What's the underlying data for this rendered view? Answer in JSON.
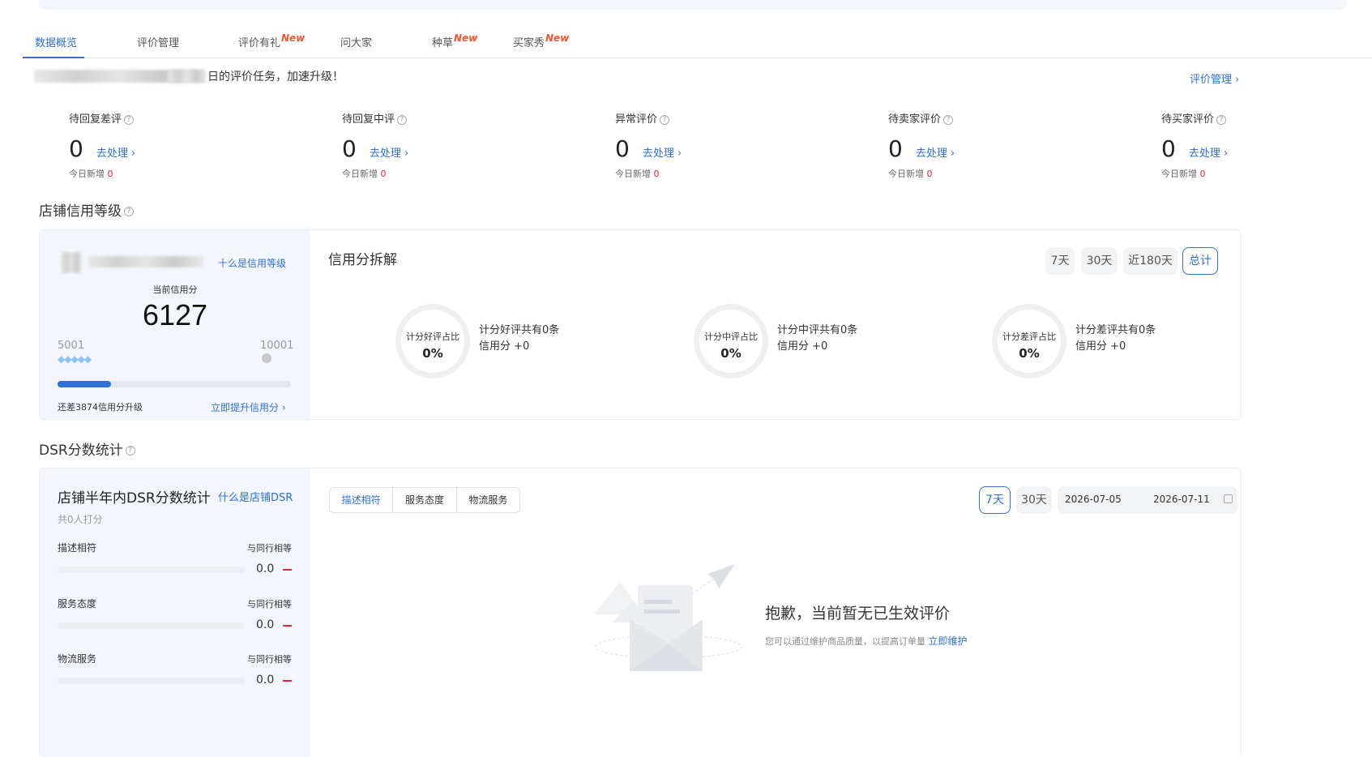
{
  "tabs": [
    {
      "label": "数据概览",
      "new": ""
    },
    {
      "label": "评价管理",
      "new": ""
    },
    {
      "label": "评价有礼",
      "new": "New"
    },
    {
      "label": "问大家",
      "new": ""
    },
    {
      "label": "种草",
      "new": "New"
    },
    {
      "label": "买家秀",
      "new": "New"
    }
  ],
  "task_message": "日的评价任务，加速升级！",
  "manage_link": "评价管理 ›",
  "stats": [
    {
      "title": "待回复差评",
      "count": "0",
      "action": "去处理 ›",
      "new_label": "今日新增",
      "new_count": "0"
    },
    {
      "title": "待回复中评",
      "count": "0",
      "action": "去处理 ›",
      "new_label": "今日新增",
      "new_count": "0"
    },
    {
      "title": "异常评价",
      "count": "0",
      "action": "去处理 ›",
      "new_label": "今日新增",
      "new_count": "0"
    },
    {
      "title": "待卖家评价",
      "count": "0",
      "action": "去处理 ›",
      "new_label": "今日新增",
      "new_count": "0"
    },
    {
      "title": "待买家评价",
      "count": "0",
      "action": "去处理 ›",
      "new_label": "今日新增",
      "new_count": "0"
    }
  ],
  "credit": {
    "section_title": "店铺信用等级",
    "what_link": "十么是信用等级",
    "current_label": "当前信用分",
    "score": "6127",
    "range_min": "5001",
    "range_max": "10001",
    "progress_fraction": 0.23,
    "remaining_text": "还差3874信用分升级",
    "improve_link": "立即提升信用分 ›",
    "breakdown_title": "信用分拆解",
    "ranges": [
      "7天",
      "30天",
      "近180天",
      "总计"
    ],
    "rings": [
      {
        "label": "计分好评占比",
        "value": "0%",
        "line1": "计分好评共有0条",
        "line2": "信用分 +0"
      },
      {
        "label": "计分中评占比",
        "value": "0%",
        "line1": "计分中评共有0条",
        "line2": "信用分 +0"
      },
      {
        "label": "计分差评占比",
        "value": "0%",
        "line1": "计分差评共有0条",
        "line2": "信用分 +0"
      }
    ]
  },
  "dsr": {
    "section_title": "DSR分数统计",
    "panel_title": "店铺半年内DSR分数统计",
    "what_link": "什么是店铺DSR",
    "count_text": "共0人打分",
    "rows": [
      {
        "label": "描述相符",
        "compare": "与同行相等",
        "value": "0.0"
      },
      {
        "label": "服务态度",
        "compare": "与同行相等",
        "value": "0.0"
      },
      {
        "label": "物流服务",
        "compare": "与同行相等",
        "value": "0.0"
      }
    ],
    "seg_tabs": [
      "描述相符",
      "服务态度",
      "物流服务"
    ],
    "ranges": [
      "7天",
      "30天"
    ],
    "date_start": "2026-07-05",
    "date_end": "2026-07-11",
    "empty_title": "抱歉，当前暂无已生效评价",
    "empty_desc": "您可以通过维护商品质量，以提高订单量",
    "empty_link": "立即维护"
  },
  "colors": {
    "accent": "#2f6fd6",
    "new_badge": "#f5532d",
    "negative": "#f5222d",
    "panel_bg": "#f3f7fd"
  }
}
